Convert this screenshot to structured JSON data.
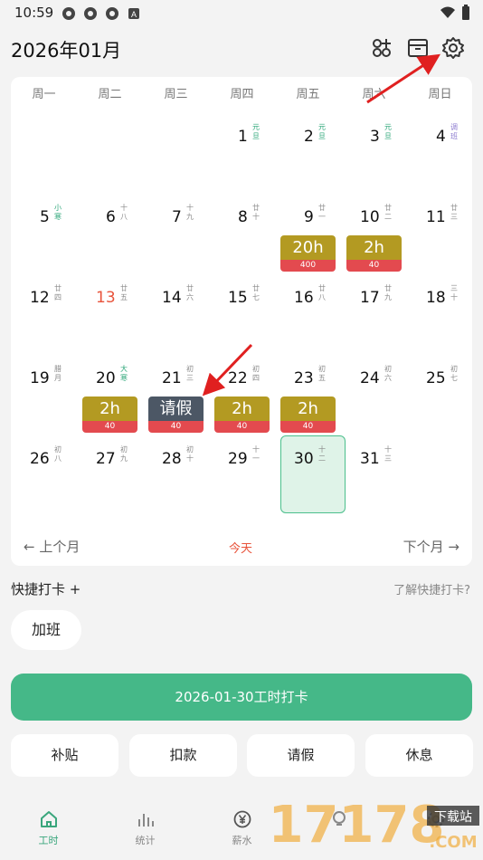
{
  "status_bar": {
    "time": "10:59"
  },
  "header": {
    "title": "2026年01月"
  },
  "calendar": {
    "weekdays": [
      "周一",
      "周二",
      "周三",
      "周四",
      "周五",
      "周六",
      "周日"
    ],
    "weeks": [
      [
        {
          "n": "",
          "l": ""
        },
        {
          "n": "",
          "l": ""
        },
        {
          "n": "",
          "l": ""
        },
        {
          "n": "1",
          "l": "元旦",
          "style": "festival"
        },
        {
          "n": "2",
          "l": "元旦",
          "style": "festival"
        },
        {
          "n": "3",
          "l": "元旦",
          "style": "festival"
        },
        {
          "n": "4",
          "l": "调班",
          "style": "purple"
        }
      ],
      [
        {
          "n": "5",
          "l": "小寒",
          "style": "festival"
        },
        {
          "n": "6",
          "l": "十八"
        },
        {
          "n": "7",
          "l": "十九"
        },
        {
          "n": "8",
          "l": "廿十"
        },
        {
          "n": "9",
          "l": "廿一",
          "badge": {
            "kind": "gold",
            "top": "20h",
            "bottom": "400"
          }
        },
        {
          "n": "10",
          "l": "廿二",
          "badge": {
            "kind": "gold",
            "top": "2h",
            "bottom": "40"
          }
        },
        {
          "n": "11",
          "l": "廿三"
        }
      ],
      [
        {
          "n": "12",
          "l": "廿四"
        },
        {
          "n": "13",
          "l": "廿五",
          "red": true
        },
        {
          "n": "14",
          "l": "廿六"
        },
        {
          "n": "15",
          "l": "廿七"
        },
        {
          "n": "16",
          "l": "廿八"
        },
        {
          "n": "17",
          "l": "廿九"
        },
        {
          "n": "18",
          "l": "三十"
        }
      ],
      [
        {
          "n": "19",
          "l": "腊月"
        },
        {
          "n": "20",
          "l": "大寒",
          "style": "festival",
          "badge": {
            "kind": "gold",
            "top": "2h",
            "bottom": "40"
          }
        },
        {
          "n": "21",
          "l": "初三",
          "badge": {
            "kind": "slate",
            "top": "请假",
            "bottom": "40"
          }
        },
        {
          "n": "22",
          "l": "初四",
          "badge": {
            "kind": "gold",
            "top": "2h",
            "bottom": "40"
          }
        },
        {
          "n": "23",
          "l": "初五",
          "badge": {
            "kind": "gold",
            "top": "2h",
            "bottom": "40"
          }
        },
        {
          "n": "24",
          "l": "初六"
        },
        {
          "n": "25",
          "l": "初七"
        }
      ],
      [
        {
          "n": "26",
          "l": "初八"
        },
        {
          "n": "27",
          "l": "初九"
        },
        {
          "n": "28",
          "l": "初十"
        },
        {
          "n": "29",
          "l": "十一"
        },
        {
          "n": "30",
          "l": "十二",
          "today": true
        },
        {
          "n": "31",
          "l": "十三"
        },
        {
          "n": "",
          "l": ""
        }
      ]
    ],
    "prev_label": "上个月",
    "today_label": "今天",
    "next_label": "下个月"
  },
  "quick": {
    "title": "快捷打卡 +",
    "help": "了解快捷打卡?",
    "chip": "加班"
  },
  "punch_button": "2026-01-30工时打卡",
  "actions": [
    "补贴",
    "扣款",
    "请假",
    "休息"
  ],
  "bottom_nav": [
    "工时",
    "统计",
    "薪水",
    "",
    ""
  ],
  "watermark": {
    "text": "17178",
    "sub": "下载站",
    "domain": ".COM"
  },
  "colors": {
    "accent": "#45b888",
    "gold": "#b39a22",
    "slate": "#4c5765",
    "red": "#e34a4f"
  }
}
